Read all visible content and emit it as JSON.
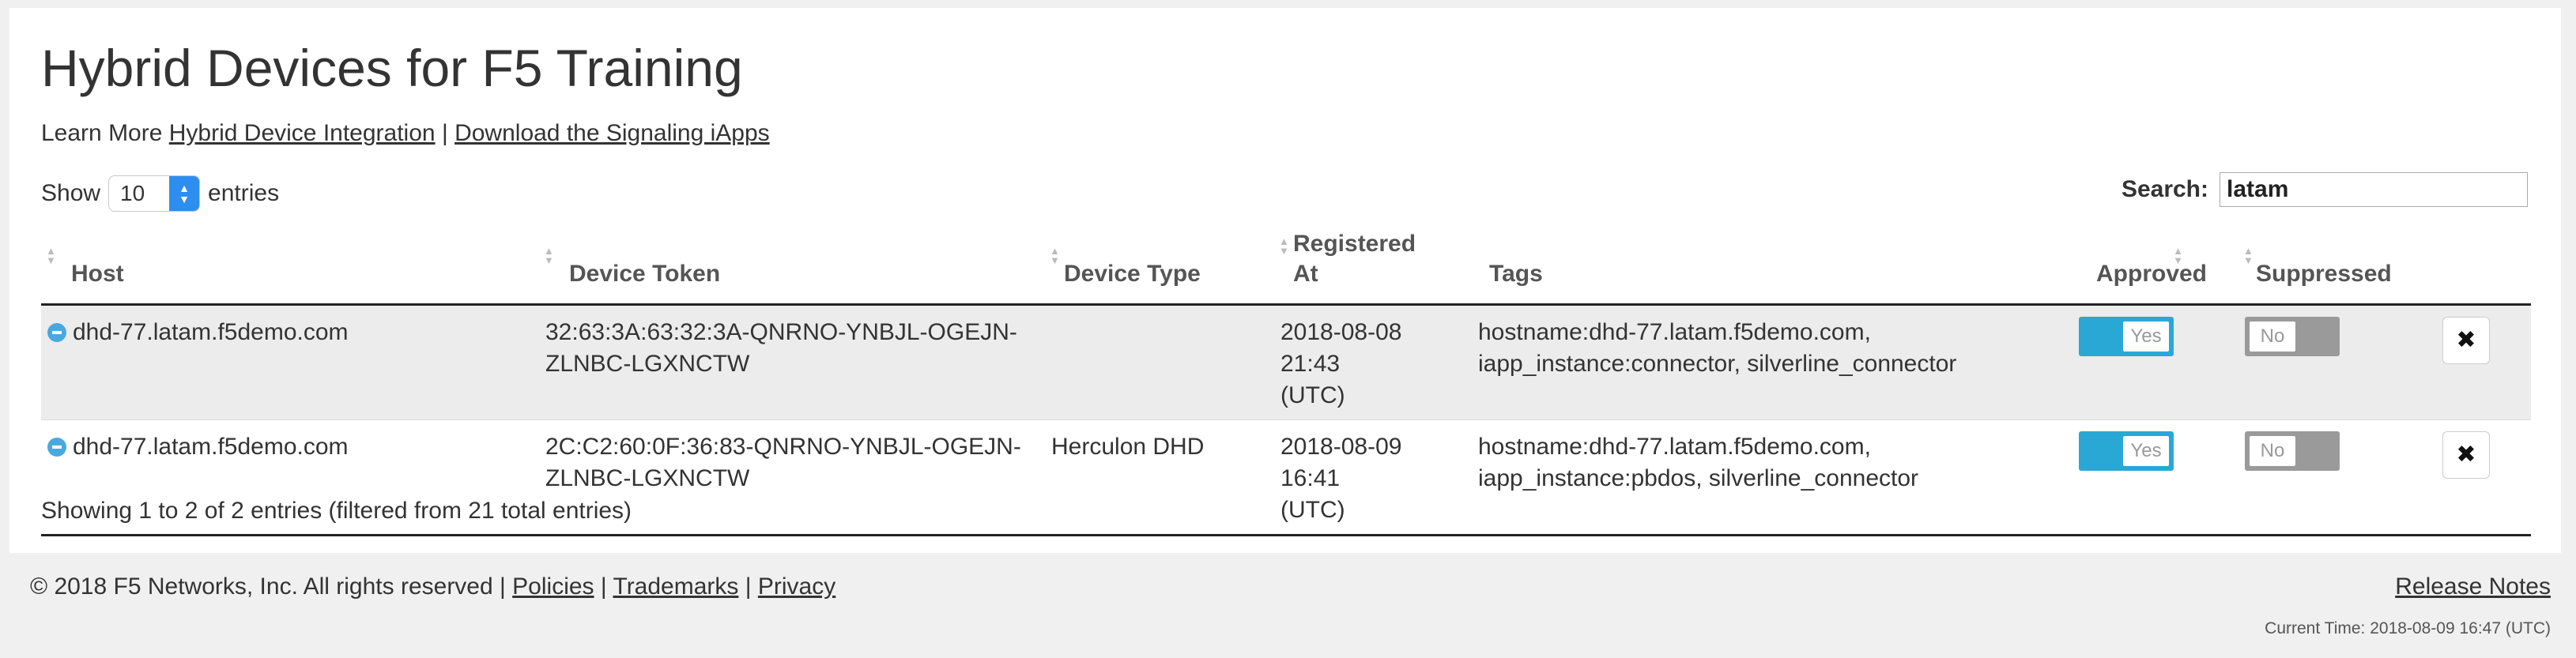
{
  "page": {
    "title": "Hybrid Devices for F5 Training",
    "learn_more_prefix": "Learn More",
    "link_integration": "Hybrid Device Integration",
    "separator": "|",
    "link_download": "Download the Signaling iApps"
  },
  "controls": {
    "show_label": "Show",
    "entries_value": "10",
    "entries_label": "entries",
    "search_label": "Search:",
    "search_value": "latam"
  },
  "table": {
    "headers": {
      "host": "Host",
      "token": "Device Token",
      "type": "Device Type",
      "registered_line1": "Registered",
      "registered_line2": "At",
      "tags": "Tags",
      "approved": "Approved",
      "suppressed": "Suppressed"
    },
    "rows": [
      {
        "host": "dhd-77.latam.f5demo.com",
        "token_line1": "32:63:3A:63:32:3A-QNRNO-YNBJL-OGEJN-",
        "token_line2": "ZLNBC-LGXNCTW",
        "type": "",
        "registered_line1": "2018-08-08 21:43",
        "registered_line2": "(UTC)",
        "tags_line1": "hostname:dhd-77.latam.f5demo.com,",
        "tags_line2": "iapp_instance:connector, silverline_connector",
        "approved": "Yes",
        "suppressed": "No",
        "delete_icon": "✖"
      },
      {
        "host": "dhd-77.latam.f5demo.com",
        "token_line1": "2C:C2:60:0F:36:83-QNRNO-YNBJL-OGEJN-",
        "token_line2": "ZLNBC-LGXNCTW",
        "type": "Herculon DHD",
        "registered_line1": "2018-08-09 16:41",
        "registered_line2": "(UTC)",
        "tags_line1": "hostname:dhd-77.latam.f5demo.com,",
        "tags_line2": "iapp_instance:pbdos, silverline_connector",
        "approved": "Yes",
        "suppressed": "No",
        "delete_icon": "✖"
      }
    ],
    "info": "Showing 1 to 2 of 2 entries (filtered from 21 total entries)"
  },
  "footer": {
    "copyright": "© 2018 F5 Networks, Inc. All rights reserved",
    "sep": "|",
    "policies": "Policies",
    "trademarks": "Trademarks",
    "privacy": "Privacy",
    "release_notes": "Release Notes",
    "current_time": "Current Time: 2018-08-09 16:47 (UTC)"
  },
  "colors": {
    "approved_on": "#29a8d6",
    "suppressed_off": "#9a9a9a",
    "select_accent": "#2e8ef0",
    "row_stripe": "#ececec"
  }
}
